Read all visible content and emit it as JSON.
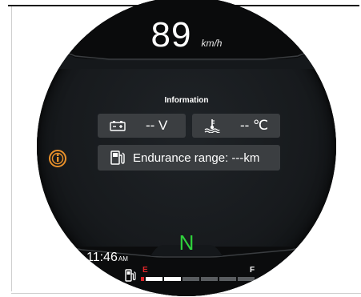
{
  "speedometer": {
    "value": "89",
    "unit": "km/h"
  },
  "info_panel": {
    "title": "Information",
    "voltage": {
      "icon": "battery-icon",
      "value": "-- V"
    },
    "temperature": {
      "icon": "coolant-temperature-icon",
      "value": "-- ℃"
    },
    "range": {
      "icon": "fuel-pump-icon",
      "value": "Endurance range: ---km"
    }
  },
  "warning": {
    "icon": "info-warning-icon",
    "color": "#e8902a"
  },
  "gear": {
    "value": "N",
    "color": "#2fd33c"
  },
  "clock": {
    "time": "11:46",
    "ampm": "AM"
  },
  "fuel": {
    "empty_label": "E",
    "full_label": "F",
    "level_segments_lit": 2,
    "total_segments": 6,
    "empty_color": "#e0262a"
  }
}
